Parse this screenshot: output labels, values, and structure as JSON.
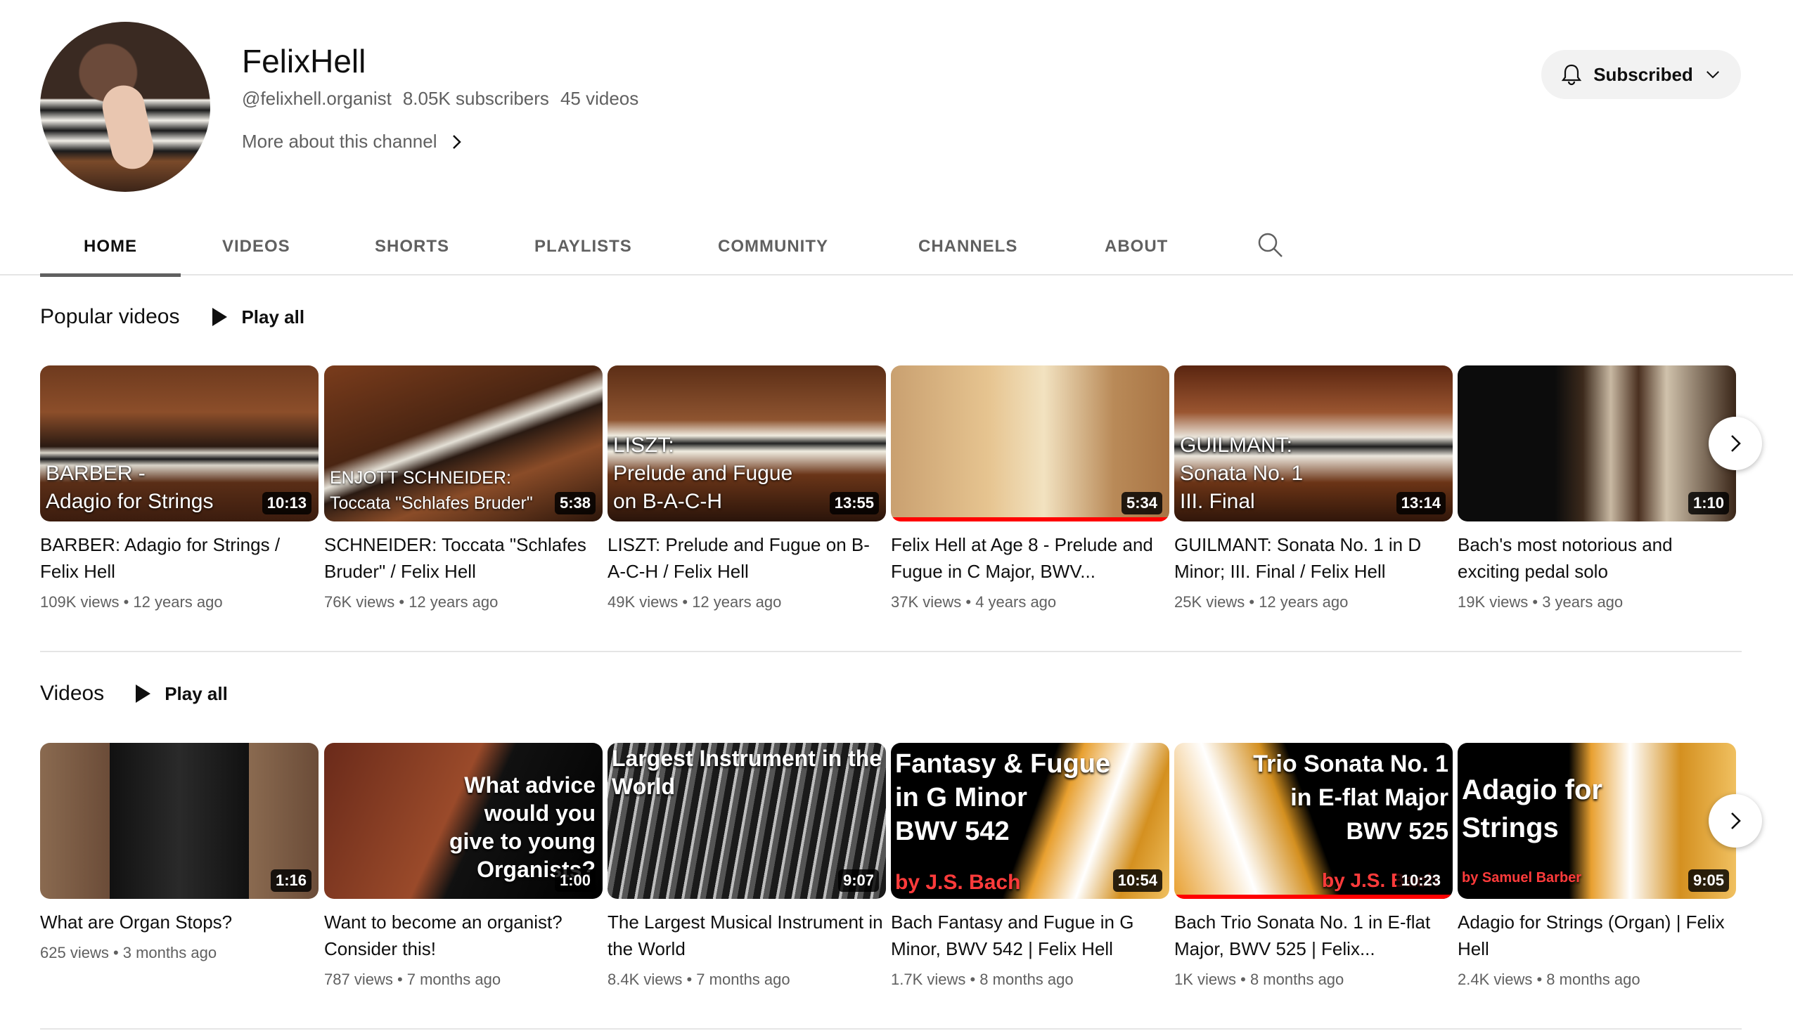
{
  "channel": {
    "name": "FelixHell",
    "handle": "@felixhell.organist",
    "subscribers": "8.05K subscribers",
    "videos": "45 videos",
    "more_label": "More about this channel",
    "subscribe_label": "Subscribed"
  },
  "tabs": [
    {
      "label": "HOME",
      "active": true
    },
    {
      "label": "VIDEOS"
    },
    {
      "label": "SHORTS"
    },
    {
      "label": "PLAYLISTS"
    },
    {
      "label": "COMMUNITY"
    },
    {
      "label": "CHANNELS"
    },
    {
      "label": "ABOUT"
    }
  ],
  "sections": {
    "popular": {
      "title": "Popular videos",
      "play_all": "Play all",
      "items": [
        {
          "thumb_text": "BARBER -\nAdagio for Strings",
          "duration": "10:13",
          "title": "BARBER: Adagio for Strings / Felix Hell",
          "stats": "109K views • 12 years ago"
        },
        {
          "thumb_text": "ENJOTT SCHNEIDER:\nToccata \"Schlafes Bruder\"",
          "duration": "5:38",
          "title": "SCHNEIDER: Toccata \"Schlafes Bruder\" / Felix Hell",
          "stats": "76K views • 12 years ago"
        },
        {
          "thumb_text": "LISZT:\nPrelude and Fugue\non B-A-C-H",
          "duration": "13:55",
          "title": "LISZT: Prelude and Fugue on B-A-C-H / Felix Hell",
          "stats": "49K views • 12 years ago"
        },
        {
          "thumb_text": "",
          "duration": "5:34",
          "title": "Felix Hell at Age 8 - Prelude and Fugue in C Major, BWV...",
          "stats": "37K views • 4 years ago",
          "progress": 1.0
        },
        {
          "thumb_text": "GUILMANT:\nSonata No. 1\nIII. Final",
          "duration": "13:14",
          "title": "GUILMANT: Sonata No. 1 in D Minor; III. Final / Felix Hell",
          "stats": "25K views • 12 years ago"
        },
        {
          "thumb_text": "",
          "duration": "1:10",
          "title": "Bach's most notorious and exciting pedal solo",
          "stats": "19K views • 3 years ago"
        }
      ]
    },
    "videos": {
      "title": "Videos",
      "play_all": "Play all",
      "items": [
        {
          "thumb_text": "",
          "duration": "1:16",
          "title": "What are Organ Stops?",
          "stats": "625 views • 3 months ago"
        },
        {
          "thumb_text": "What advice\nwould you\ngive to young\nOrganists?",
          "duration": "1:00",
          "title": "Want to become an organist? Consider this!",
          "stats": "787 views • 7 months ago"
        },
        {
          "thumb_text": "Largest Instrument in the World",
          "duration": "9:07",
          "title": "The Largest Musical Instrument in the World",
          "stats": "8.4K views • 7 months ago"
        },
        {
          "thumb_text": "Fantasy & Fugue\nin G Minor\nBWV 542",
          "thumb_sub": "by J.S. Bach",
          "duration": "10:54",
          "title": "Bach Fantasy and Fugue in G Minor, BWV 542 | Felix Hell",
          "stats": "1.7K views • 8 months ago"
        },
        {
          "thumb_text": "Trio Sonata No. 1\nin E-flat Major\nBWV 525",
          "thumb_sub": "by J.S. Bach",
          "duration": "10:23",
          "title": "Bach Trio Sonata No. 1 in E-flat Major, BWV 525 | Felix...",
          "stats": "1K views • 8 months ago",
          "progress": 1.0
        },
        {
          "thumb_text": "Adagio for\nStrings",
          "thumb_sub": "by Samuel Barber",
          "duration": "9:05",
          "title": "Adagio for Strings (Organ) | Felix Hell",
          "stats": "2.4K views • 8 months ago"
        }
      ]
    }
  },
  "icons": {
    "subscribe": "bell-icon",
    "dropdown": "chevron-down-icon",
    "more": "chevron-right-icon",
    "search": "search-icon",
    "play": "play-icon",
    "next": "chevron-right-icon"
  },
  "colors": {
    "progress": "#ff0000",
    "muted_text": "#606060"
  }
}
